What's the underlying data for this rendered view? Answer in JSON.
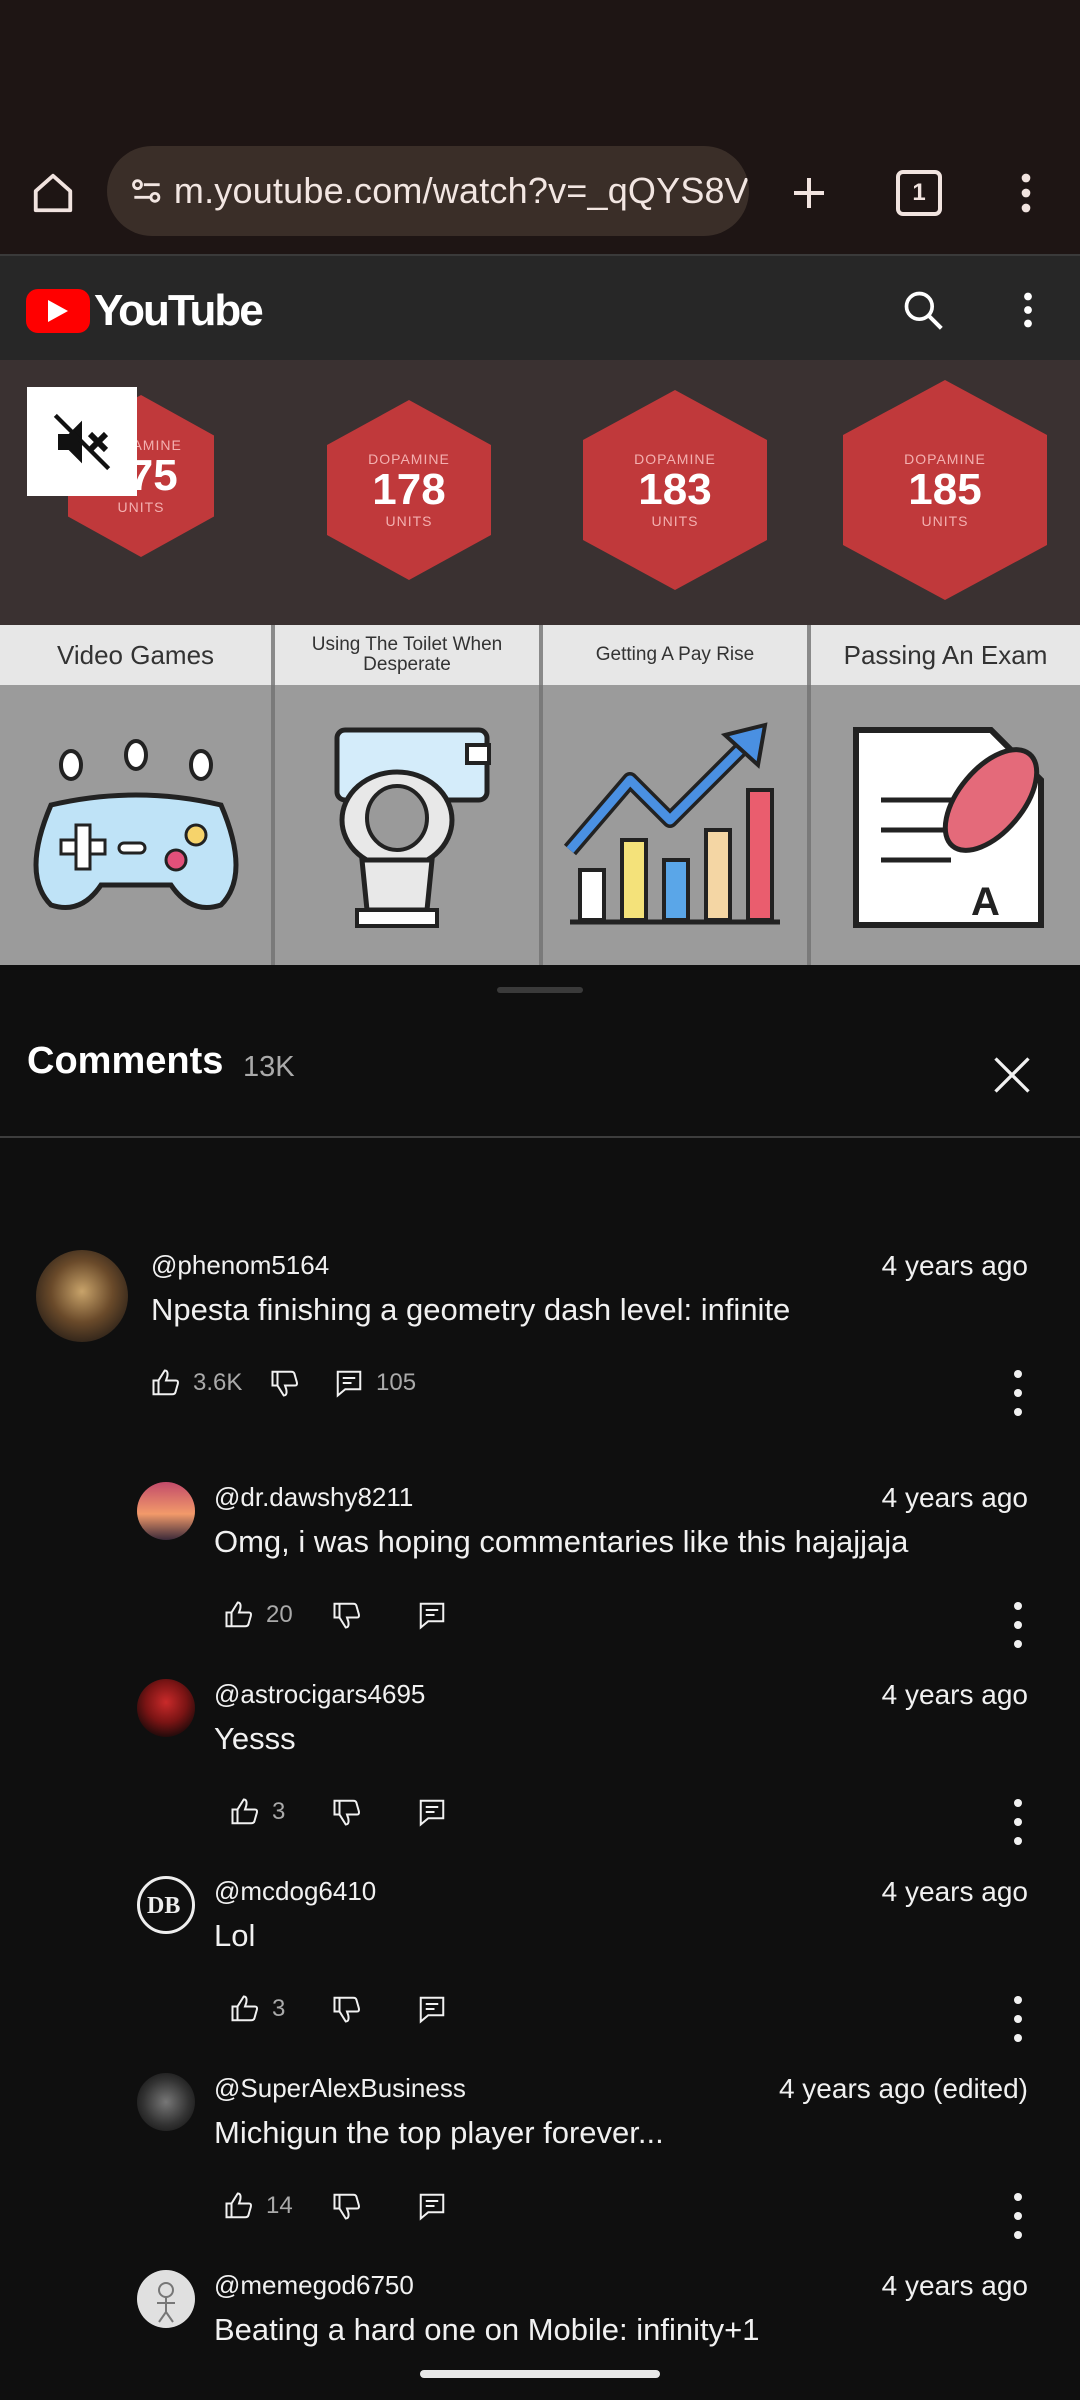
{
  "browser": {
    "url": "m.youtube.com/watch?v=_qQYS8V",
    "tab_count": "1"
  },
  "youtube": {
    "logo_text": "YouTube"
  },
  "video": {
    "hexes": [
      {
        "label": "DOPAMINE",
        "value": "175",
        "unit": "UNITS"
      },
      {
        "label": "DOPAMINE",
        "value": "178",
        "unit": "UNITS"
      },
      {
        "label": "DOPAMINE",
        "value": "183",
        "unit": "UNITS"
      },
      {
        "label": "DOPAMINE",
        "value": "185",
        "unit": "UNITS"
      }
    ],
    "categories": [
      "Video Games",
      "Using The Toilet When Desperate",
      "Getting A Pay Rise",
      "Passing An Exam"
    ]
  },
  "comments": {
    "title": "Comments",
    "count": "13K",
    "items": [
      {
        "author": "@phenom5164",
        "time": "4 years ago",
        "text": "Npesta finishing a geometry dash level: infinite",
        "likes": "3.6K",
        "replies": "105"
      },
      {
        "author": "@dr.dawshy8211",
        "time": "4 years ago",
        "text": "Omg, i was hoping commentaries like this hajajjaja",
        "likes": "20"
      },
      {
        "author": "@astrocigars4695",
        "time": "4 years ago",
        "text": "Yesss",
        "likes": "3"
      },
      {
        "author": "@mcdog6410",
        "time": "4 years ago",
        "text": "Lol",
        "likes": "3"
      },
      {
        "author": "@SuperAlexBusiness",
        "time": "4 years ago (edited)",
        "text": "Michigun the top player forever...",
        "likes": "14"
      },
      {
        "author": "@memegod6750",
        "time": "4 years ago",
        "text": "Beating a hard one on Mobile: infinity+1"
      }
    ]
  },
  "colors": {
    "brand_red": "#ff0000",
    "hex_red": "#c0393b",
    "background": "#0f0f0f"
  }
}
